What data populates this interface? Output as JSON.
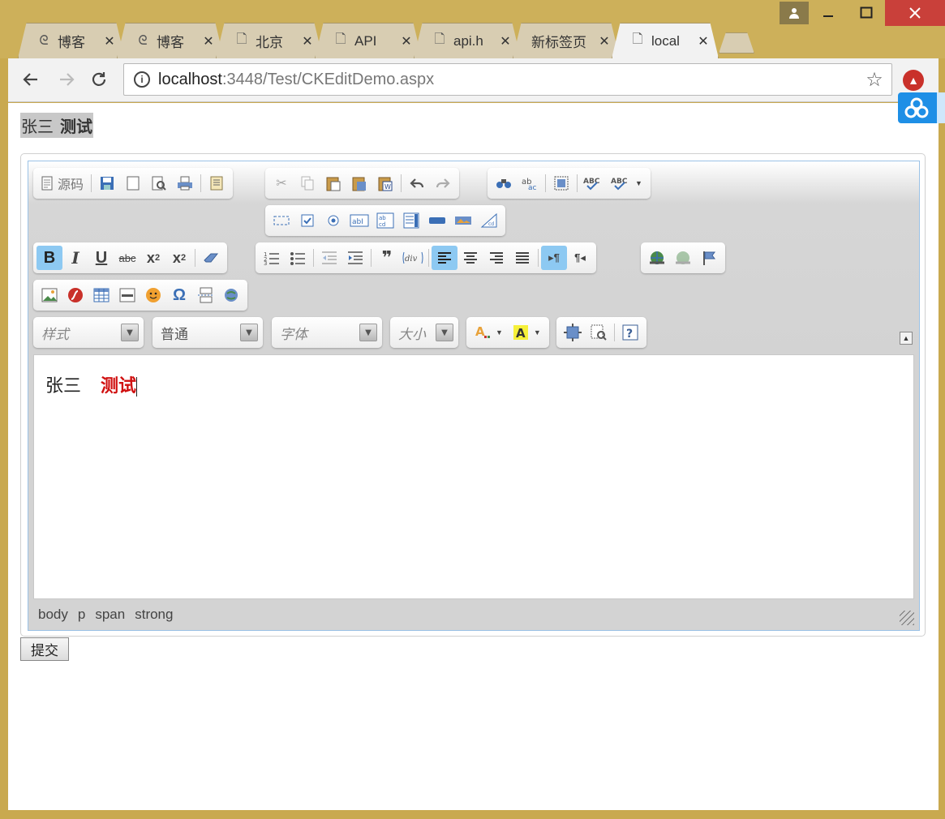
{
  "browser": {
    "tabs": [
      {
        "label": "博客",
        "icon": "blog-icon"
      },
      {
        "label": "博客",
        "icon": "blog-icon"
      },
      {
        "label": "北京",
        "icon": "page-icon"
      },
      {
        "label": "API",
        "icon": "page-icon"
      },
      {
        "label": "api.h",
        "icon": "page-icon"
      },
      {
        "label": "新标签页",
        "icon": "none"
      },
      {
        "label": "local",
        "icon": "page-icon",
        "active": true
      }
    ],
    "url_host": "localhost",
    "url_path": ":3448/Test/CKEditDemo.aspx"
  },
  "page": {
    "preview_name": "张三",
    "preview_bold": "测试",
    "submit_label": "提交"
  },
  "editor": {
    "source_label": "源码",
    "combos": {
      "styles": "样式",
      "format": "普通",
      "font": "字体",
      "size": "大小"
    },
    "content_name": "张三",
    "content_red": "测试",
    "breadcrumbs": [
      "body",
      "p",
      "span",
      "strong"
    ],
    "colors": {
      "border": "#9bc2e6",
      "active_button": "#8dc9f2",
      "red_text": "#d01010"
    }
  }
}
